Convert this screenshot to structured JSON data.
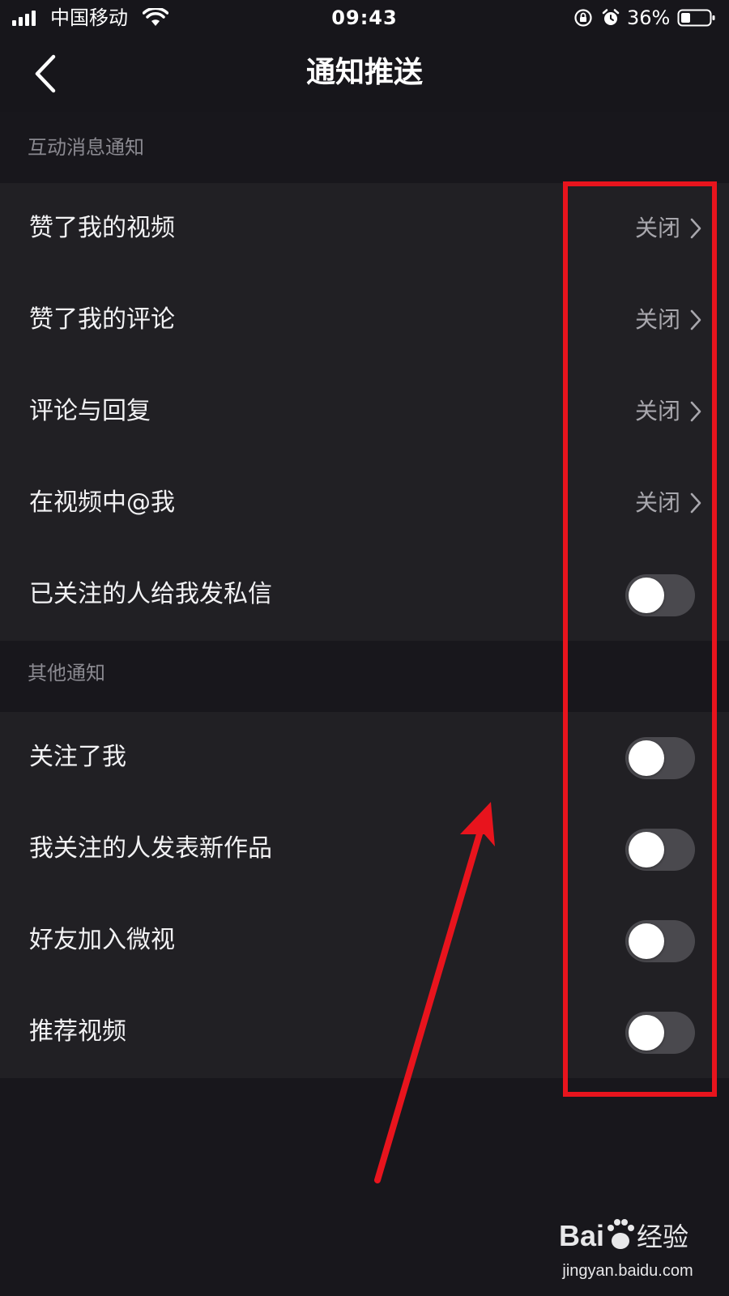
{
  "status_bar": {
    "carrier": "中国移动",
    "time": "09:43",
    "battery_percent": "36%",
    "icons": [
      "signal-icon",
      "wifi-icon",
      "rotation-lock-icon",
      "alarm-icon",
      "battery-icon"
    ]
  },
  "nav": {
    "back_icon": "chevron-left-icon",
    "title": "通知推送"
  },
  "sections": {
    "interaction": {
      "header": "互动消息通知",
      "rows": [
        {
          "label": "赞了我的视频",
          "status": "关闭",
          "type": "link"
        },
        {
          "label": "赞了我的评论",
          "status": "关闭",
          "type": "link"
        },
        {
          "label": "评论与回复",
          "status": "关闭",
          "type": "link"
        },
        {
          "label": "在视频中@我",
          "status": "关闭",
          "type": "link"
        },
        {
          "label": "已关注的人给我发私信",
          "type": "toggle",
          "on": false
        }
      ]
    },
    "other": {
      "header": "其他通知",
      "rows": [
        {
          "label": "关注了我",
          "type": "toggle",
          "on": false
        },
        {
          "label": "我关注的人发表新作品",
          "type": "toggle",
          "on": false
        },
        {
          "label": "好友加入微视",
          "type": "toggle",
          "on": false
        },
        {
          "label": "推荐视频",
          "type": "toggle",
          "on": false
        }
      ]
    }
  },
  "colors": {
    "background": "#18171c",
    "row_background": "#212024",
    "annotation": "#e8141d",
    "toggle_off": "#4a494e"
  },
  "watermark": {
    "logo_text_left": "Bai",
    "logo_text_right": "经验",
    "url": "jingyan.baidu.com"
  }
}
